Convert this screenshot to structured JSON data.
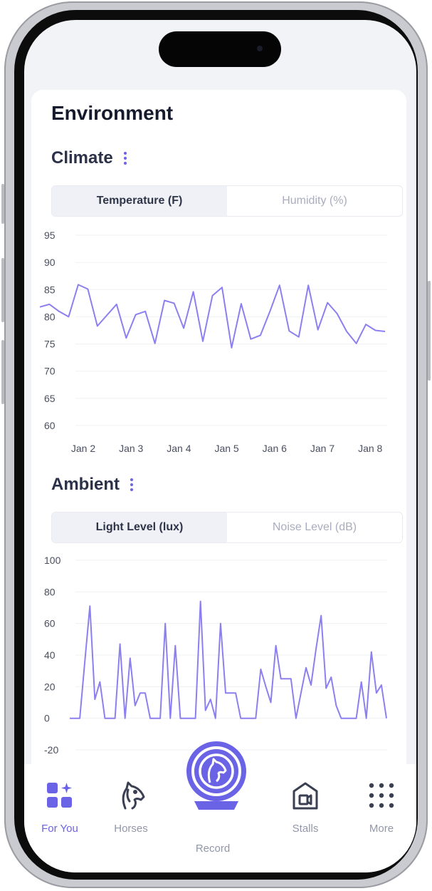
{
  "page": {
    "title": "Environment"
  },
  "climate": {
    "title": "Climate",
    "menu_icon": "kebab-menu-icon",
    "tabs": [
      "Temperature (F)",
      "Humidity (%)"
    ],
    "active_tab": 0
  },
  "ambient": {
    "title": "Ambient",
    "menu_icon": "kebab-menu-icon",
    "tabs": [
      "Light Level (lux)",
      "Noise Level (dB)"
    ],
    "active_tab": 0
  },
  "chart_data": [
    {
      "type": "line",
      "title": "",
      "xlabel": "",
      "ylabel": "",
      "x_ticks": [
        "Jan 2",
        "Jan 3",
        "Jan 4",
        "Jan 5",
        "Jan 6",
        "Jan 7",
        "Jan 8"
      ],
      "ylim": [
        58,
        96
      ],
      "y_ticks": [
        60,
        65,
        70,
        75,
        80,
        85,
        90,
        95
      ],
      "grid": true,
      "color": "#8c7ff0",
      "series": [
        {
          "values": [
            81.8,
            82.3,
            81.0,
            80.0,
            85.9,
            85.1,
            78.3,
            80.3,
            82.3,
            76.1,
            80.4,
            81.0,
            75.1,
            83.0,
            82.5,
            77.9,
            84.6,
            75.5,
            83.9,
            85.4,
            74.3,
            82.4,
            75.9,
            76.6,
            81.0,
            85.8,
            77.4,
            76.3,
            85.8,
            77.6,
            82.6,
            80.6,
            77.3,
            75.1,
            78.6,
            77.5,
            77.3
          ]
        }
      ]
    },
    {
      "type": "line",
      "title": "",
      "xlabel": "",
      "ylabel": "",
      "ylim": [
        -22,
        102
      ],
      "y_ticks": [
        -20,
        0,
        20,
        40,
        60,
        80,
        100
      ],
      "grid": true,
      "color": "#8c7ff0",
      "series": [
        {
          "values": [
            0,
            0,
            0,
            36,
            71,
            12,
            23,
            0,
            0,
            0,
            47,
            0,
            38,
            8,
            16,
            16,
            0,
            0,
            0,
            60,
            0,
            46,
            0,
            0,
            0,
            0,
            74,
            5,
            12,
            0,
            60,
            16,
            16,
            16,
            0,
            0,
            0,
            0,
            31,
            20,
            10,
            46,
            25,
            25,
            25,
            0,
            16,
            32,
            21,
            44,
            65,
            19,
            26,
            8,
            0,
            0,
            0,
            0,
            23,
            0,
            42,
            16,
            21,
            0
          ]
        }
      ]
    }
  ],
  "nav": {
    "items": [
      {
        "label": "For You",
        "icon": "for-you-grid-icon",
        "active": true
      },
      {
        "label": "Horses",
        "icon": "horse-head-icon",
        "active": false
      },
      {
        "label": "Record",
        "icon": "record-horse-radar-icon",
        "active": false
      },
      {
        "label": "Stalls",
        "icon": "stall-barn-icon",
        "active": false
      },
      {
        "label": "More",
        "icon": "more-grid-icon",
        "active": false
      }
    ]
  },
  "colors": {
    "accent": "#6b63e6",
    "line": "#8c7ff0",
    "title": "#151a2d"
  }
}
